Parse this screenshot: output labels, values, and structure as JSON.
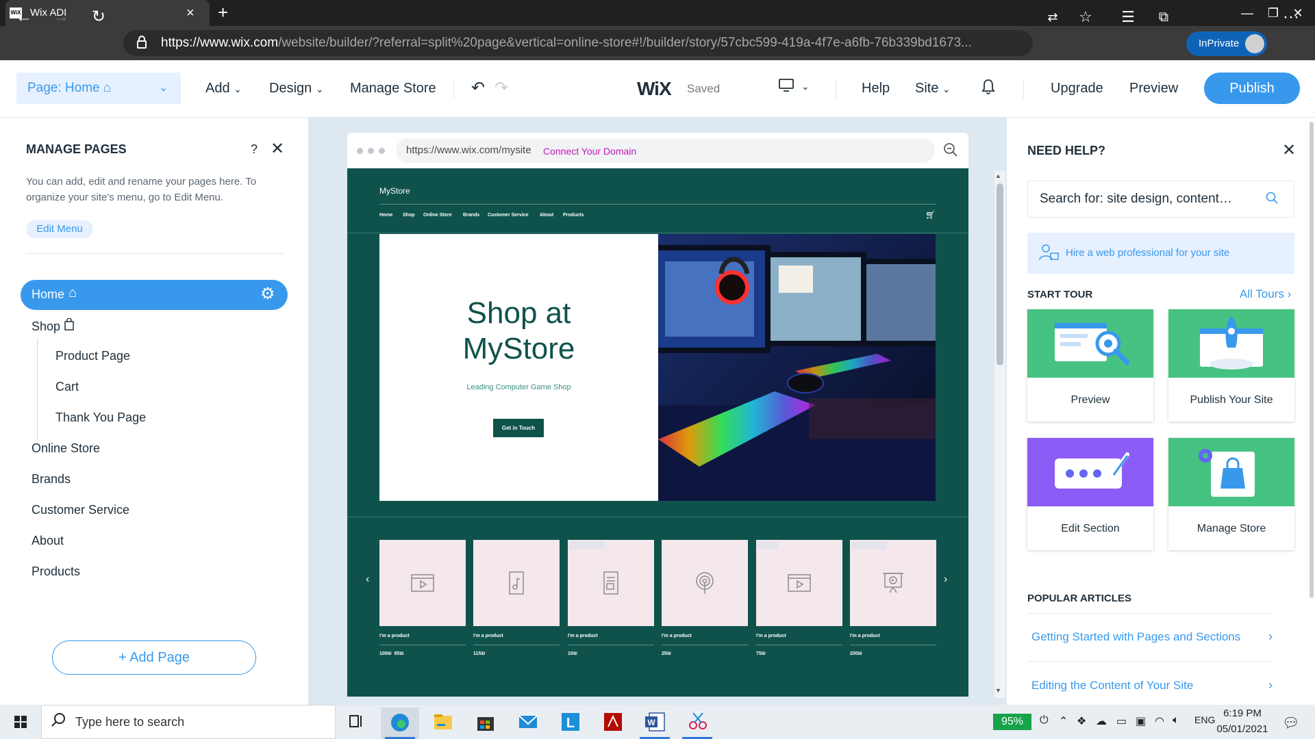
{
  "browser": {
    "tab_title": "Wix ADI",
    "url_host": "https://www.wix.com",
    "url_path": "/website/builder/?referral=split%20page&vertical=online-store#!/builder/story/57cbc599-419a-4f7e-a6fb-76b339bd1673...",
    "inprivate_label": "InPrivate"
  },
  "toolbar": {
    "page_select": "Page: Home",
    "add": "Add",
    "design": "Design",
    "manage_store": "Manage Store",
    "logo": "WiX",
    "saved": "Saved",
    "help": "Help",
    "site": "Site",
    "upgrade": "Upgrade",
    "preview": "Preview",
    "publish": "Publish"
  },
  "manage_pages": {
    "title": "MANAGE PAGES",
    "help": "?",
    "description": "You can add, edit and rename your pages here. To organize your site's menu, go to Edit Menu.",
    "edit_menu": "Edit Menu",
    "pages": [
      {
        "label": "Home",
        "level": 0,
        "selected": true
      },
      {
        "label": "Shop",
        "level": 0
      },
      {
        "label": "Product Page",
        "level": 1
      },
      {
        "label": "Cart",
        "level": 1
      },
      {
        "label": "Thank You Page",
        "level": 1
      },
      {
        "label": "Online Store",
        "level": 0
      },
      {
        "label": "Brands",
        "level": 0
      },
      {
        "label": "Customer Service",
        "level": 0
      },
      {
        "label": "About",
        "level": 0
      },
      {
        "label": "Products",
        "level": 0
      }
    ],
    "add_page": "+ Add Page"
  },
  "site_preview": {
    "url": "https://www.wix.com/mysite",
    "connect_domain": "Connect Your Domain",
    "store_name": "MyStore",
    "nav": [
      "Home",
      "Shop",
      "Online Store",
      "Brands",
      "Customer Service",
      "About",
      "Products"
    ],
    "hero_title_line1": "Shop at",
    "hero_title_line2": "MyStore",
    "hero_subtitle": "Leading Computer Game Shop",
    "hero_button": "Get in Touch",
    "products": [
      {
        "name": "I'm a product",
        "price": "100₪",
        "sale_price": "85₪",
        "icon": "video-icon"
      },
      {
        "name": "I'm a product",
        "price": "115₪",
        "icon": "music-note-icon"
      },
      {
        "name": "I'm a product",
        "price": "10₪",
        "icon": "ebook-icon"
      },
      {
        "name": "I'm a product",
        "price": "25₪",
        "icon": "podcast-icon"
      },
      {
        "name": "I'm a product",
        "price": "75₪",
        "icon": "video-icon"
      },
      {
        "name": "I'm a product",
        "price": "200₪",
        "icon": "presentation-icon"
      }
    ]
  },
  "need_help": {
    "title": "NEED HELP?",
    "search_placeholder": "Search for: site design, content…",
    "hire_text": "Hire a web professional for your site",
    "start_tour": "START TOUR",
    "all_tours": "All Tours",
    "tours": [
      {
        "label": "Preview",
        "color": "#46c283"
      },
      {
        "label": "Publish Your Site",
        "color": "#46c283"
      },
      {
        "label": "Edit Section",
        "color": "#8b5cf6"
      },
      {
        "label": "Manage Store",
        "color": "#46c283"
      }
    ],
    "popular_articles": "POPULAR ARTICLES",
    "articles": [
      "Getting Started with Pages and Sections",
      "Editing the Content of Your Site"
    ]
  },
  "taskbar": {
    "search_text": "Type here to search",
    "battery": "95%",
    "language": "ENG",
    "time": "6:19 PM",
    "date": "05/01/2021"
  },
  "colors": {
    "accent": "#3899ec",
    "site_bg": "#0f524c",
    "product_card": "#f4e8ec"
  }
}
